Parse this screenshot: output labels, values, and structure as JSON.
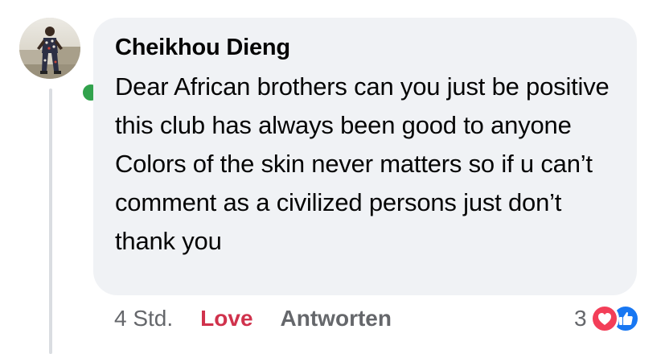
{
  "comment": {
    "author": "Cheikhou Dieng",
    "text": "Dear African brothers can you just be positive this club has always been good to anyone Colors of the skin never matters so if u can’t comment as a civilized persons just don’t thank you",
    "online": true
  },
  "actions": {
    "timestamp": "4 Std.",
    "love_label": "Love",
    "reply_label": "Antworten"
  },
  "reactions": {
    "count": "3",
    "icons": [
      "heart-reaction-icon",
      "like-reaction-icon"
    ]
  },
  "colors": {
    "bubble_bg": "#f0f2f5",
    "love_red": "#d0324c",
    "online_green": "#31a24c",
    "like_blue": "#1877f2",
    "secondary_text": "#65676b"
  }
}
